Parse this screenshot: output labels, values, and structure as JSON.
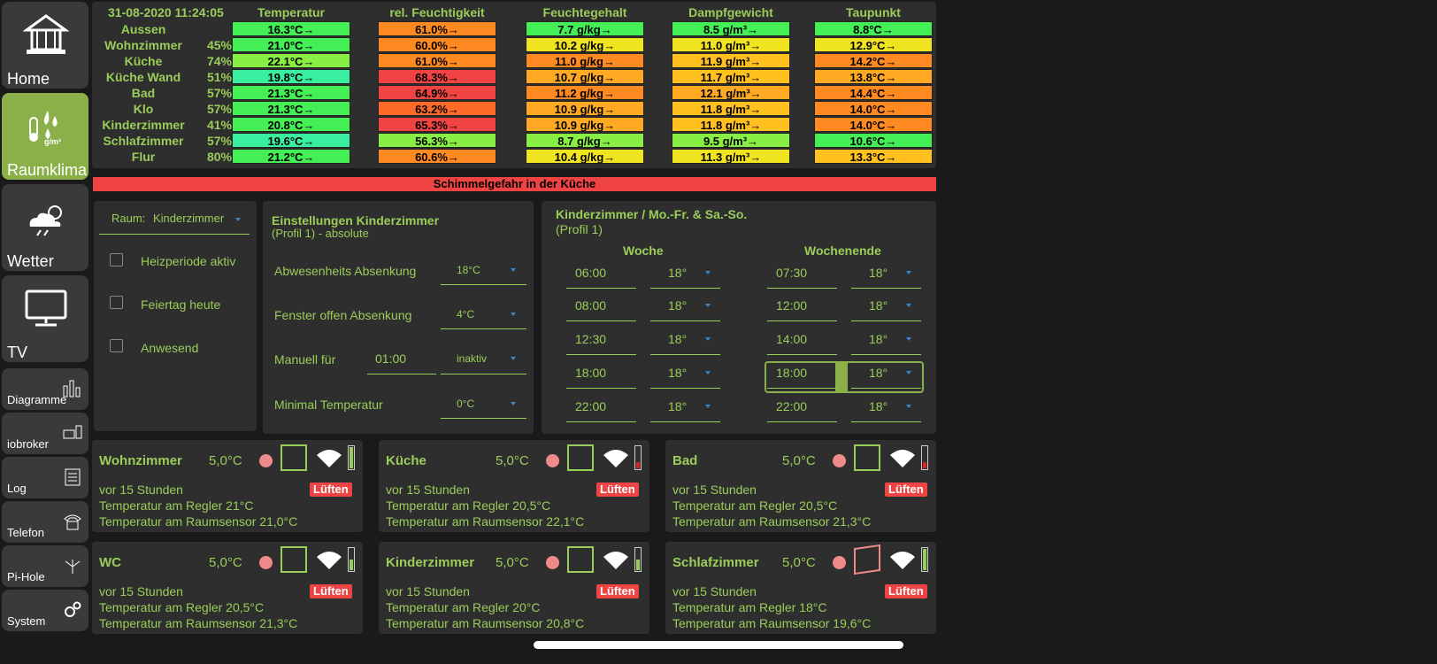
{
  "sidebar": {
    "big": [
      {
        "label": "Home",
        "icon": "house-icon"
      },
      {
        "label": "Raumklima",
        "icon": "humidity-icon",
        "icon_text": "g/m³"
      },
      {
        "label": "Wetter",
        "icon": "weather-icon"
      },
      {
        "label": "TV",
        "icon": "tv-icon"
      }
    ],
    "small": [
      {
        "label": "Diagramme",
        "icon": "bar-chart-icon"
      },
      {
        "label": "iobroker",
        "icon": "devices-icon"
      },
      {
        "label": "Log",
        "icon": "log-icon"
      },
      {
        "label": "Telefon",
        "icon": "phone-icon"
      },
      {
        "label": "Pi-Hole",
        "icon": "pihole-icon"
      },
      {
        "label": "System",
        "icon": "gears-icon"
      }
    ]
  },
  "climate": {
    "datetime": "31-08-2020 11:24:05",
    "headers": [
      "Temperatur",
      "rel. Feuchtigkeit",
      "Feuchtegehalt",
      "Dampfgewicht",
      "Taupunkt"
    ],
    "rows": [
      {
        "name": "Aussen",
        "pct": "",
        "vals": [
          "16.3°C→",
          "61.0%→",
          "7.7 g/kg→",
          "8.5 g/m³→",
          "8.8°C→"
        ],
        "colors": [
          "#44ee55",
          "#ff8a22",
          "#44ee55",
          "#44ee55",
          "#44ee55"
        ]
      },
      {
        "name": "Wohnzimmer",
        "pct": "45%",
        "vals": [
          "21.0°C→",
          "60.0%→",
          "10.2 g/kg→",
          "11.0 g/m³→",
          "12.9°C→"
        ],
        "colors": [
          "#44ee55",
          "#ff8a22",
          "#f0e420",
          "#f0e420",
          "#f0e420"
        ]
      },
      {
        "name": "Küche",
        "pct": "74%",
        "vals": [
          "22.1°C→",
          "61.0%→",
          "11.0 g/kg→",
          "11.9 g/m³→",
          "14.2°C→"
        ],
        "colors": [
          "#88ee44",
          "#ff8a22",
          "#ff8a22",
          "#ffc020",
          "#ff8a22"
        ]
      },
      {
        "name": "Küche Wand",
        "pct": "51%",
        "vals": [
          "19.8°C→",
          "68.3%→",
          "10.7 g/kg→",
          "11.7 g/m³→",
          "13.8°C→"
        ],
        "colors": [
          "#3aeea0",
          "#f04444",
          "#ffaa22",
          "#ffc020",
          "#ffaa22"
        ]
      },
      {
        "name": "Bad",
        "pct": "57%",
        "vals": [
          "21.3°C→",
          "64.9%→",
          "11.2 g/kg→",
          "12.1 g/m³→",
          "14.4°C→"
        ],
        "colors": [
          "#44ee55",
          "#f04444",
          "#ff8a22",
          "#ffaa22",
          "#ff8a22"
        ]
      },
      {
        "name": "Klo",
        "pct": "57%",
        "vals": [
          "21.3°C→",
          "63.2%→",
          "10.9 g/kg→",
          "11.8 g/m³→",
          "14.0°C→"
        ],
        "colors": [
          "#44ee55",
          "#ff6a2a",
          "#ffaa22",
          "#ffc020",
          "#ff8a22"
        ]
      },
      {
        "name": "Kinderzimmer",
        "pct": "41%",
        "vals": [
          "20.8°C→",
          "65.3%→",
          "10.9 g/kg→",
          "11.8 g/m³→",
          "14.0°C→"
        ],
        "colors": [
          "#44ee55",
          "#f04444",
          "#ffaa22",
          "#ffc020",
          "#ff8a22"
        ]
      },
      {
        "name": "Schlafzimmer",
        "pct": "57%",
        "vals": [
          "19.6°C→",
          "56.3%→",
          "8.7 g/kg→",
          "9.5 g/m³→",
          "10.6°C→"
        ],
        "colors": [
          "#3aeea0",
          "#88ee44",
          "#88ee44",
          "#88ee44",
          "#44ee55"
        ]
      },
      {
        "name": "Flur",
        "pct": "80%",
        "vals": [
          "21.2°C→",
          "60.6%→",
          "10.4 g/kg→",
          "11.3 g/m³→",
          "13.3°C→"
        ],
        "colors": [
          "#44ee55",
          "#ff8a22",
          "#f0e420",
          "#f0e420",
          "#ffc020"
        ]
      }
    ]
  },
  "alert": "Schimmelgefahr in der Küche",
  "room": {
    "label": "Raum:",
    "value": "Kinderzimmer",
    "checks": [
      "Heizperiode aktiv",
      "Feiertag heute",
      "Anwesend"
    ]
  },
  "settings": {
    "title": "Einstellungen Kinderzimmer",
    "subtitle": "(Profil 1) - absolute",
    "abw_label": "Abwesenheits Absenkung",
    "abw_value": "18°C",
    "fenster_label": "Fenster offen Absenkung",
    "fenster_value": "4°C",
    "manuell_label": "Manuell für",
    "manuell_time": "01:00",
    "manuell_value": "inaktiv",
    "min_label": "Minimal Temperatur",
    "min_value": "0°C"
  },
  "schedule": {
    "title": "Kinderzimmer / Mo.-Fr. & Sa.-So.",
    "subtitle": "(Profil 1)",
    "woche_label": "Woche",
    "wochenende_label": "Wochenende",
    "woche": [
      [
        "06:00",
        "18°"
      ],
      [
        "08:00",
        "18°"
      ],
      [
        "12:30",
        "18°"
      ],
      [
        "18:00",
        "18°"
      ],
      [
        "22:00",
        "18°"
      ]
    ],
    "wochenende": [
      [
        "07:30",
        "18°"
      ],
      [
        "12:00",
        "18°"
      ],
      [
        "14:00",
        "18°"
      ],
      [
        "18:00",
        "18°"
      ],
      [
        "22:00",
        "18°"
      ]
    ]
  },
  "cards": [
    {
      "name": "Wohnzimmer",
      "temp": "5,0°C",
      "ago": "vor 15 Stunden",
      "badge": "Lüften",
      "regler": "Temperatur am Regler 21°C",
      "sensor": "Temperatur am Raumsensor 21,0°C",
      "battery": 1.0,
      "bat_color": "#9acd5a",
      "window_open": false
    },
    {
      "name": "Küche",
      "temp": "5,0°C",
      "ago": "vor 15 Stunden",
      "badge": "Lüften",
      "regler": "Temperatur am Regler 20,5°C",
      "sensor": "Temperatur am Raumsensor 22,1°C",
      "battery": 0.3,
      "bat_color": "#e02020",
      "window_open": false
    },
    {
      "name": "Bad",
      "temp": "5,0°C",
      "ago": "vor 15 Stunden",
      "badge": "Lüften",
      "regler": "Temperatur am Regler 20,5°C",
      "sensor": "Temperatur am Raumsensor 21,3°C",
      "battery": 0.3,
      "bat_color": "#e02020",
      "window_open": false
    },
    {
      "name": "WC",
      "temp": "5,0°C",
      "ago": "vor 15 Stunden",
      "badge": "Lüften",
      "regler": "Temperatur am Regler 20,5°C",
      "sensor": "Temperatur am Raumsensor 21,3°C",
      "battery": 0.5,
      "bat_color": "#9acd5a",
      "window_open": false
    },
    {
      "name": "Kinderzimmer",
      "temp": "5,0°C",
      "ago": "vor 15 Stunden",
      "badge": "Lüften",
      "regler": "Temperatur am Regler 20°C",
      "sensor": "Temperatur am Raumsensor 20,8°C",
      "battery": 0.5,
      "bat_color": "#9acd5a",
      "window_open": false
    },
    {
      "name": "Schlafzimmer",
      "temp": "5,0°C",
      "ago": "vor 15 Stunden",
      "badge": "Lüften",
      "regler": "Temperatur am Regler 18°C",
      "sensor": "Temperatur am Raumsensor 19,6°C",
      "battery": 1.0,
      "bat_color": "#9acd5a",
      "window_open": true
    }
  ],
  "colors": {
    "accent": "#9acd5a",
    "alert": "#f04444",
    "panel": "#2e2e2e",
    "background": "#1a1a1a"
  }
}
